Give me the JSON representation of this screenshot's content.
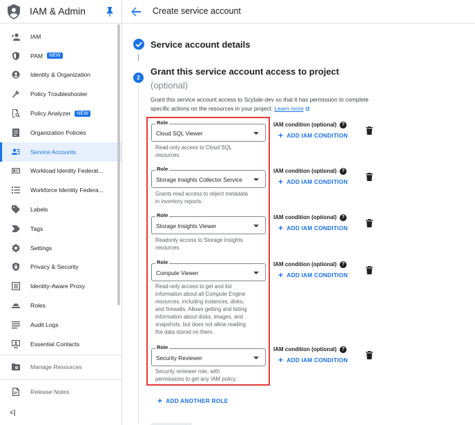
{
  "app": {
    "title": "IAM & Admin"
  },
  "sidebar": {
    "items": [
      {
        "label": "IAM",
        "icon": "person-add-icon",
        "name": "sidebar-item-iam"
      },
      {
        "label": "PAM",
        "icon": "shield-icon",
        "name": "sidebar-item-pam",
        "badge": "NEW"
      },
      {
        "label": "Identity & Organization",
        "icon": "identity-icon",
        "name": "sidebar-item-identity-organization"
      },
      {
        "label": "Policy Troubleshooter",
        "icon": "wrench-icon",
        "name": "sidebar-item-policy-troubleshooter"
      },
      {
        "label": "Policy Analyzer",
        "icon": "document-search-icon",
        "name": "sidebar-item-policy-analyzer",
        "badge": "NEW"
      },
      {
        "label": "Organization Policies",
        "icon": "list-document-icon",
        "name": "sidebar-item-organization-policies"
      },
      {
        "label": "Service Accounts",
        "icon": "service-account-icon",
        "name": "sidebar-item-service-accounts",
        "active": true
      },
      {
        "label": "Workload Identity Federat...",
        "icon": "id-card-icon",
        "name": "sidebar-item-workload-identity"
      },
      {
        "label": "Workforce Identity Federa...",
        "icon": "list-icon",
        "name": "sidebar-item-workforce-identity"
      },
      {
        "label": "Labels",
        "icon": "tag-icon",
        "name": "sidebar-item-labels"
      },
      {
        "label": "Tags",
        "icon": "chevron-tag-icon",
        "name": "sidebar-item-tags"
      },
      {
        "label": "Settings",
        "icon": "gear-icon",
        "name": "sidebar-item-settings"
      },
      {
        "label": "Privacy & Security",
        "icon": "shield-lock-icon",
        "name": "sidebar-item-privacy-security"
      },
      {
        "label": "Identity-Aware Proxy",
        "icon": "proxy-icon",
        "name": "sidebar-item-identity-aware-proxy"
      },
      {
        "label": "Roles",
        "icon": "hat-icon",
        "name": "sidebar-item-roles"
      },
      {
        "label": "Audit Logs",
        "icon": "lines-icon",
        "name": "sidebar-item-audit-logs"
      },
      {
        "label": "Essential Contacts",
        "icon": "contact-icon",
        "name": "sidebar-item-essential-contacts"
      }
    ],
    "bottom_items": [
      {
        "label": "Manage Resources",
        "icon": "folder-gear-icon",
        "name": "sidebar-item-manage-resources"
      },
      {
        "label": "Release Notes",
        "icon": "notes-icon",
        "name": "sidebar-item-release-notes"
      }
    ],
    "collapse_label": "<|"
  },
  "header": {
    "title": "Create service account"
  },
  "step1": {
    "title": "Service account details"
  },
  "step2": {
    "number": "2",
    "title": "Grant this service account access to project",
    "subtitle": "(optional)",
    "description": "Grant this service account access to Scytale-dev so that it has permission to complete specific actions on the resources in your project.",
    "learn_more": "Learn more"
  },
  "roles": [
    {
      "legend": "Role",
      "value": "Cloud SQL Viewer",
      "description": "Read-only access to Cloud SQL resources."
    },
    {
      "legend": "Role",
      "value": "Storage Insights Collector Service",
      "description": "Grants read access to object metadata in inventory reports."
    },
    {
      "legend": "Role",
      "value": "Storage Insights Viewer",
      "description": "Readonly access to Storage Insights resources."
    },
    {
      "legend": "Role",
      "value": "Compute Viewer",
      "description": "Read-only access to get and list information about all Compute Engine resources, including instances, disks, and firewalls. Allows getting and listing information about disks, images, and snapshots, but does not allow reading the data stored on them."
    },
    {
      "legend": "Role",
      "value": "Security Reviewer",
      "description": "Security reviewer role, with permissions to get any IAM policy."
    }
  ],
  "iam_condition": {
    "label": "IAM condition (optional)",
    "help": "?",
    "add_label": "ADD IAM CONDITION"
  },
  "add_another_role": "ADD ANOTHER ROLE",
  "colors": {
    "accent": "#1a73e8",
    "highlight": "#e53935"
  }
}
